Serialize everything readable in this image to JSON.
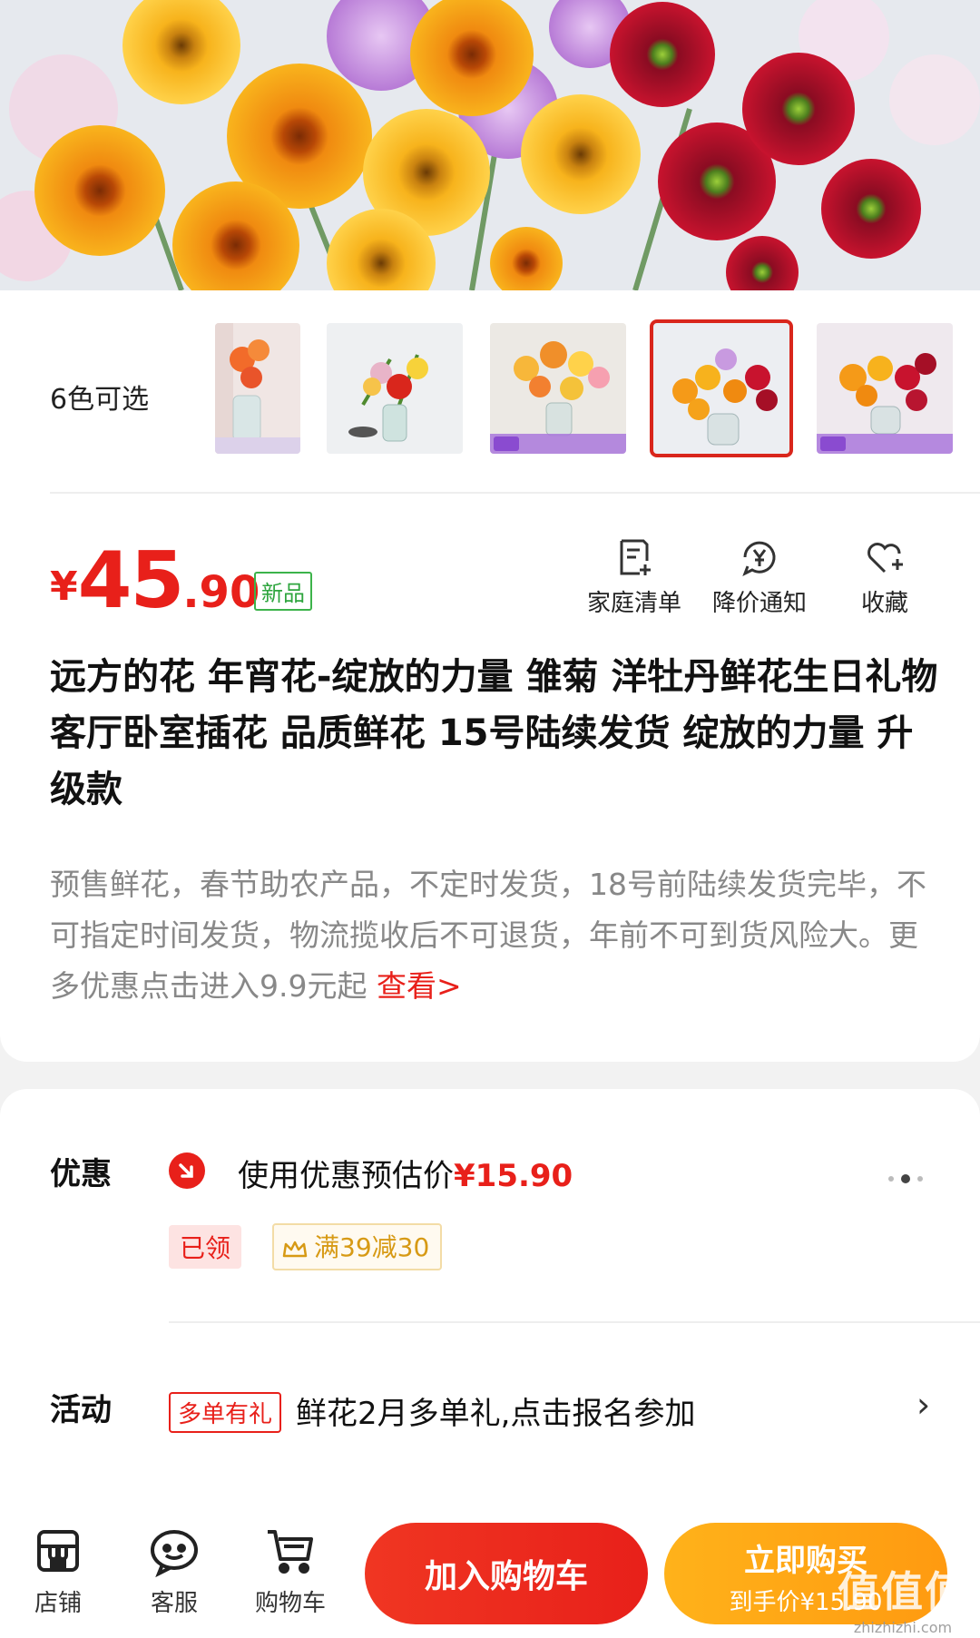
{
  "variants": {
    "label": "6色可选",
    "thumbnails": [
      {
        "name": "variant-1",
        "selected": false
      },
      {
        "name": "variant-2",
        "selected": false
      },
      {
        "name": "variant-3",
        "selected": false
      },
      {
        "name": "variant-4",
        "selected": true
      },
      {
        "name": "variant-5",
        "selected": false
      }
    ]
  },
  "price": {
    "currency": "¥",
    "integer": "45",
    "decimal": ".90",
    "tag": "新品"
  },
  "actions": [
    {
      "label": "家庭清单",
      "icon": "list-add-icon"
    },
    {
      "label": "降价通知",
      "icon": "price-alert-icon"
    },
    {
      "label": "收藏",
      "icon": "heart-icon"
    }
  ],
  "product": {
    "title": "远方的花 年宵花-绽放的力量 雏菊 洋牡丹鲜花生日礼物 客厅卧室插花 品质鲜花 15号陆续发货 绽放的力量 升级款",
    "description": "预售鲜花，春节助农产品，不定时发货，18号前陆续发货完毕，不可指定时间发货，物流揽收后不可退货，年前不可到货风险大。更多优惠点击进入9.9元起 ",
    "more_link": "查看>"
  },
  "promo": {
    "label": "优惠",
    "estimate_text": "使用优惠预估价",
    "estimate_price": "¥15.90",
    "claimed": "已领",
    "deal": "满39减30"
  },
  "event": {
    "label": "活动",
    "tag": "多单有礼",
    "text": "鲜花2月多单礼,点击报名参加",
    "chevron": "›"
  },
  "bottom_nav": {
    "store": "店铺",
    "service": "客服",
    "cart": "购物车",
    "add_to_cart": "加入购物车",
    "buy_now": "立即购买",
    "buy_now_sub": "到手价¥15.90"
  },
  "watermark": {
    "text": "值值值",
    "sub": "zhizhizhi.com"
  },
  "colors": {
    "accent": "#e8201a",
    "buy": "#ffa414",
    "new_tag": "#3cb34a",
    "deal": "#d79a15"
  }
}
